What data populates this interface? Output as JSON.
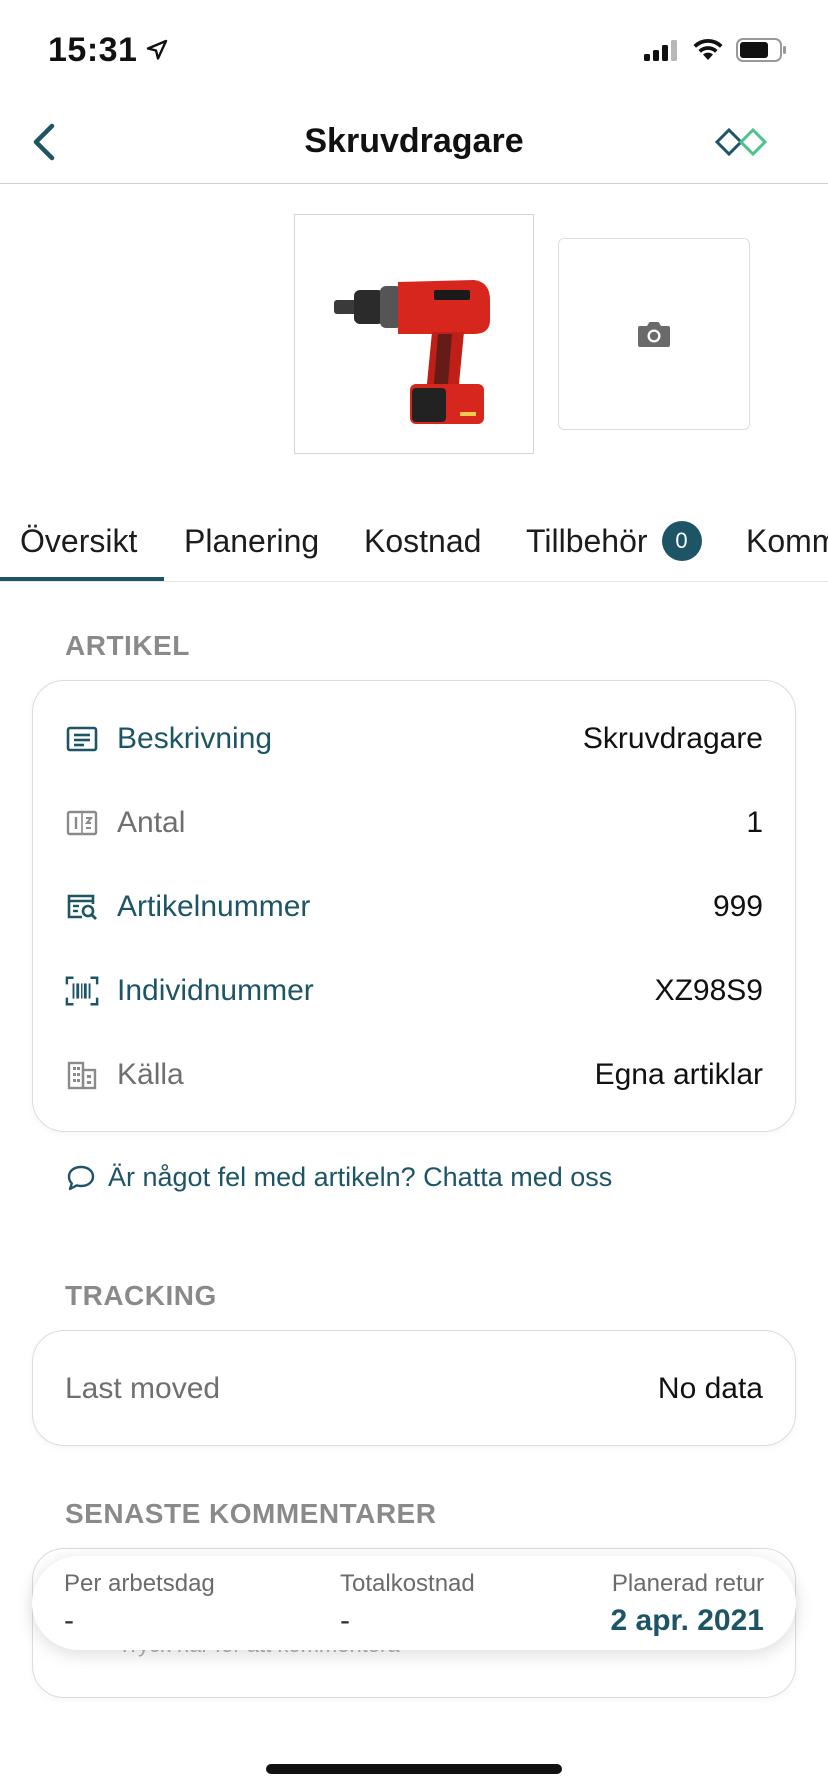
{
  "status_bar": {
    "time": "15:31"
  },
  "nav": {
    "title": "Skruvdragare"
  },
  "tabs": [
    {
      "label": "Översikt",
      "active": true
    },
    {
      "label": "Planering"
    },
    {
      "label": "Kostnad"
    },
    {
      "label": "Tillbehör",
      "badge": "0"
    },
    {
      "label": "Komm"
    }
  ],
  "artikel": {
    "header": "ARTIKEL",
    "rows": [
      {
        "label": "Beskrivning",
        "value": "Skruvdragare",
        "icon": "description-icon"
      },
      {
        "label": "Antal",
        "value": "1",
        "icon": "quantity-icon"
      },
      {
        "label": "Artikelnummer",
        "value": "999",
        "icon": "article-search-icon"
      },
      {
        "label": "Individnummer",
        "value": "XZ98S9",
        "icon": "barcode-icon"
      },
      {
        "label": "Källa",
        "value": "Egna artiklar",
        "icon": "building-icon"
      }
    ],
    "chat_link": "Är något fel med artikeln? Chatta med oss"
  },
  "tracking": {
    "header": "TRACKING",
    "label": "Last moved",
    "value": "No data"
  },
  "comments": {
    "header": "SENASTE KOMMENTARER",
    "hint": "Tryck här för att kommentera"
  },
  "summary": {
    "per_day_label": "Per arbetsdag",
    "per_day_value": "-",
    "total_label": "Totalkostnad",
    "total_value": "-",
    "return_label": "Planerad retur",
    "return_value": "2 apr. 2021"
  },
  "colors": {
    "accent": "#1d5566",
    "logo_green": "#4cc38a"
  }
}
